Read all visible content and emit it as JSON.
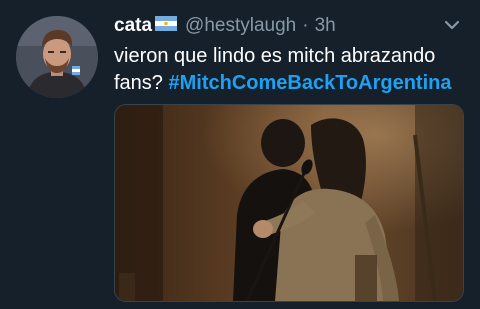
{
  "tweet": {
    "display_name": "cata",
    "handle": "@hestylaugh",
    "separator": "·",
    "time": "3h",
    "text_line1": "vieron que lindo es mitch abrazando",
    "text_line2_prefix": "fans? ",
    "hashtag": "#MitchComeBackToArgentina"
  },
  "icons": {
    "flag": "argentina-flag-emoji",
    "caret": "chevron-down-icon"
  },
  "colors": {
    "background": "#15202b",
    "text_primary": "#ffffff",
    "text_secondary": "#8899a6",
    "link": "#1da1f2"
  }
}
